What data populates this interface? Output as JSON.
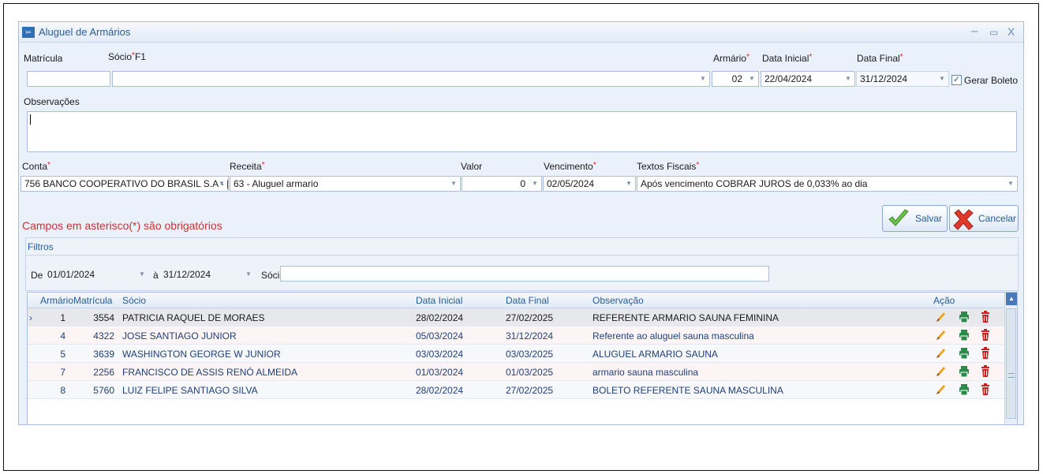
{
  "window": {
    "title": "Aluguel de Armários",
    "minimize": "–",
    "maximize": "▭",
    "close": "X"
  },
  "form": {
    "matricula_label": "Matrícula",
    "matricula_value": "",
    "socio_label": "Sócio",
    "socio_hint": "F1",
    "socio_value": "",
    "armario_label": "Armário",
    "armario_value": "02",
    "data_inicial_label": "Data Inicial",
    "data_inicial_value": "22/04/2024",
    "data_final_label": "Data Final",
    "data_final_value": "31/12/2024",
    "gerar_boleto_label": "Gerar Boleto",
    "gerar_boleto_checked": true,
    "observacoes_label": "Observações",
    "observacoes_value": "",
    "conta_label": "Conta",
    "conta_value": "756 BANCO COOPERATIVO DO BRASIL S.A - |",
    "receita_label": "Receita",
    "receita_value": "63 - Aluguel armario",
    "valor_label": "Valor",
    "valor_value": "0",
    "vencimento_label": "Vencimento",
    "vencimento_value": "02/05/2024",
    "textos_fiscais_label": "Textos Fiscais",
    "textos_fiscais_value": "Após vencimento COBRAR JUROS de 0,033% ao dia",
    "required_mark": "*"
  },
  "required_hint": "Campos em asterisco(*) são obrigatórios",
  "buttons": {
    "salvar": "Salvar",
    "cancelar": "Cancelar"
  },
  "filters": {
    "title": "Filtros",
    "de_label": "De",
    "de_value": "01/01/2024",
    "a_label": "à",
    "a_value": "31/12/2024",
    "socio_label": "Sócio",
    "socio_value": ""
  },
  "grid": {
    "headers": {
      "armario": "Armário",
      "matricula": "Matrícula",
      "socio": "Sócio",
      "data_inicial": "Data Inicial",
      "data_final": "Data Final",
      "observacao": "Observação",
      "acao": "Ação"
    },
    "rows": [
      {
        "armario": "1",
        "matricula": "3554",
        "socio": "PATRICIA RAQUEL DE MORAES",
        "data_inicial": "28/02/2024",
        "data_final": "27/02/2025",
        "observacao": "REFERENTE  ARMARIO SAUNA FEMININA",
        "selected": true
      },
      {
        "armario": "4",
        "matricula": "4322",
        "socio": "JOSE SANTIAGO JUNIOR",
        "data_inicial": "05/03/2024",
        "data_final": "31/12/2024",
        "observacao": "Referente ao aluguel sauna masculina",
        "selected": false
      },
      {
        "armario": "5",
        "matricula": "3639",
        "socio": "WASHINGTON GEORGE W JUNIOR",
        "data_inicial": "03/03/2024",
        "data_final": "03/03/2025",
        "observacao": "ALUGUEL ARMARIO SAUNA",
        "selected": false
      },
      {
        "armario": "7",
        "matricula": "2256",
        "socio": "FRANCISCO DE ASSIS RENÓ ALMEIDA",
        "data_inicial": "01/03/2024",
        "data_final": "01/03/2025",
        "observacao": "armario sauna masculina",
        "selected": false
      },
      {
        "armario": "8",
        "matricula": "5760",
        "socio": "LUIZ FELIPE SANTIAGO SILVA",
        "data_inicial": "28/02/2024",
        "data_final": "27/02/2025",
        "observacao": "BOLETO REFERENTE SAUNA MASCULINA",
        "selected": false
      }
    ],
    "row_actions": [
      "edit-icon",
      "print-icon",
      "delete-icon"
    ]
  },
  "colors": {
    "accent": "#2a5b9c",
    "required": "#e02020",
    "edit": "#f0a020",
    "print": "#2a8a4a",
    "delete": "#d02020"
  }
}
